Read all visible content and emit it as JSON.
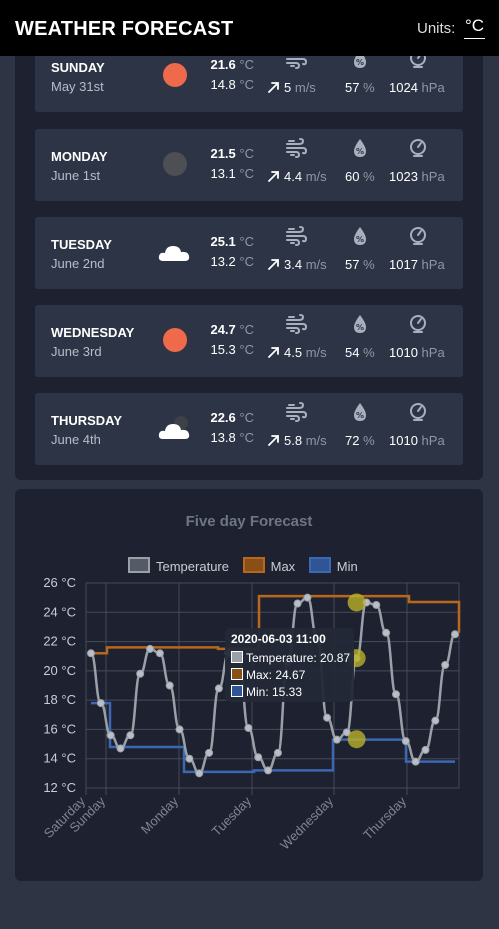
{
  "header": {
    "title": "WEATHER FORECAST",
    "units_label": "Units:",
    "units_value": "°C"
  },
  "forecast": {
    "temp_unit": "°C",
    "wind_unit": "m/s",
    "humidity_unit": "%",
    "pressure_unit": "hPa",
    "days": [
      {
        "name": "SUNDAY",
        "date": "May 31st",
        "icon": "sun-icon",
        "max": "21.6",
        "min": "14.8",
        "wind": "5",
        "humidity": "57",
        "pressure": "1024"
      },
      {
        "name": "MONDAY",
        "date": "June 1st",
        "icon": "moon-icon",
        "max": "21.5",
        "min": "13.1",
        "wind": "4.4",
        "humidity": "60",
        "pressure": "1023"
      },
      {
        "name": "TUESDAY",
        "date": "June 2nd",
        "icon": "cloud-icon",
        "max": "25.1",
        "min": "13.2",
        "wind": "3.4",
        "humidity": "57",
        "pressure": "1017"
      },
      {
        "name": "WEDNESDAY",
        "date": "June 3rd",
        "icon": "sun-icon",
        "max": "24.7",
        "min": "15.3",
        "wind": "4.5",
        "humidity": "54",
        "pressure": "1010"
      },
      {
        "name": "THURSDAY",
        "date": "June 4th",
        "icon": "cloud-night-icon",
        "max": "22.6",
        "min": "13.8",
        "wind": "5.8",
        "humidity": "72",
        "pressure": "1010"
      }
    ]
  },
  "colors": {
    "temperature": "#9aa0a8",
    "max": "#b8681c",
    "min": "#3b67b3",
    "highlight": "#b8b028"
  },
  "chart_data": {
    "type": "line",
    "title": "Five day Forecast",
    "ylim": [
      12,
      26
    ],
    "yticks": [
      "26 °C",
      "24 °C",
      "22 °C",
      "20 °C",
      "18 °C",
      "16 °C",
      "14 °C",
      "12 °C"
    ],
    "xticks": [
      "Saturday",
      "Sunday",
      "Monday",
      "Tuesday",
      "Wednesday",
      "Thursday"
    ],
    "grid": true,
    "legend_position": "top",
    "series": [
      {
        "name": "Temperature",
        "values": [
          21.2,
          17.8,
          15.6,
          14.7,
          15.6,
          19.8,
          21.5,
          21.2,
          19.0,
          16.0,
          14.0,
          13.0,
          14.4,
          18.8,
          21.2,
          21.0,
          16.1,
          14.1,
          13.2,
          14.4,
          20.6,
          24.6,
          25.0,
          22.2,
          16.8,
          15.3,
          15.8,
          20.87,
          24.67,
          24.5,
          22.6,
          18.4,
          15.2,
          13.8,
          14.6,
          16.6,
          20.4,
          22.5
        ]
      },
      {
        "name": "Max",
        "values": [
          21.2,
          21.6,
          21.5,
          25.1,
          24.7,
          22.6
        ]
      },
      {
        "name": "Min",
        "values": [
          17.8,
          14.8,
          13.1,
          13.2,
          15.3,
          13.8
        ]
      }
    ],
    "tooltip": {
      "title": "2020-06-03 11:00",
      "temperature": "Temperature: 20.87",
      "max": "Max: 24.67",
      "min": "Min: 15.33"
    }
  }
}
